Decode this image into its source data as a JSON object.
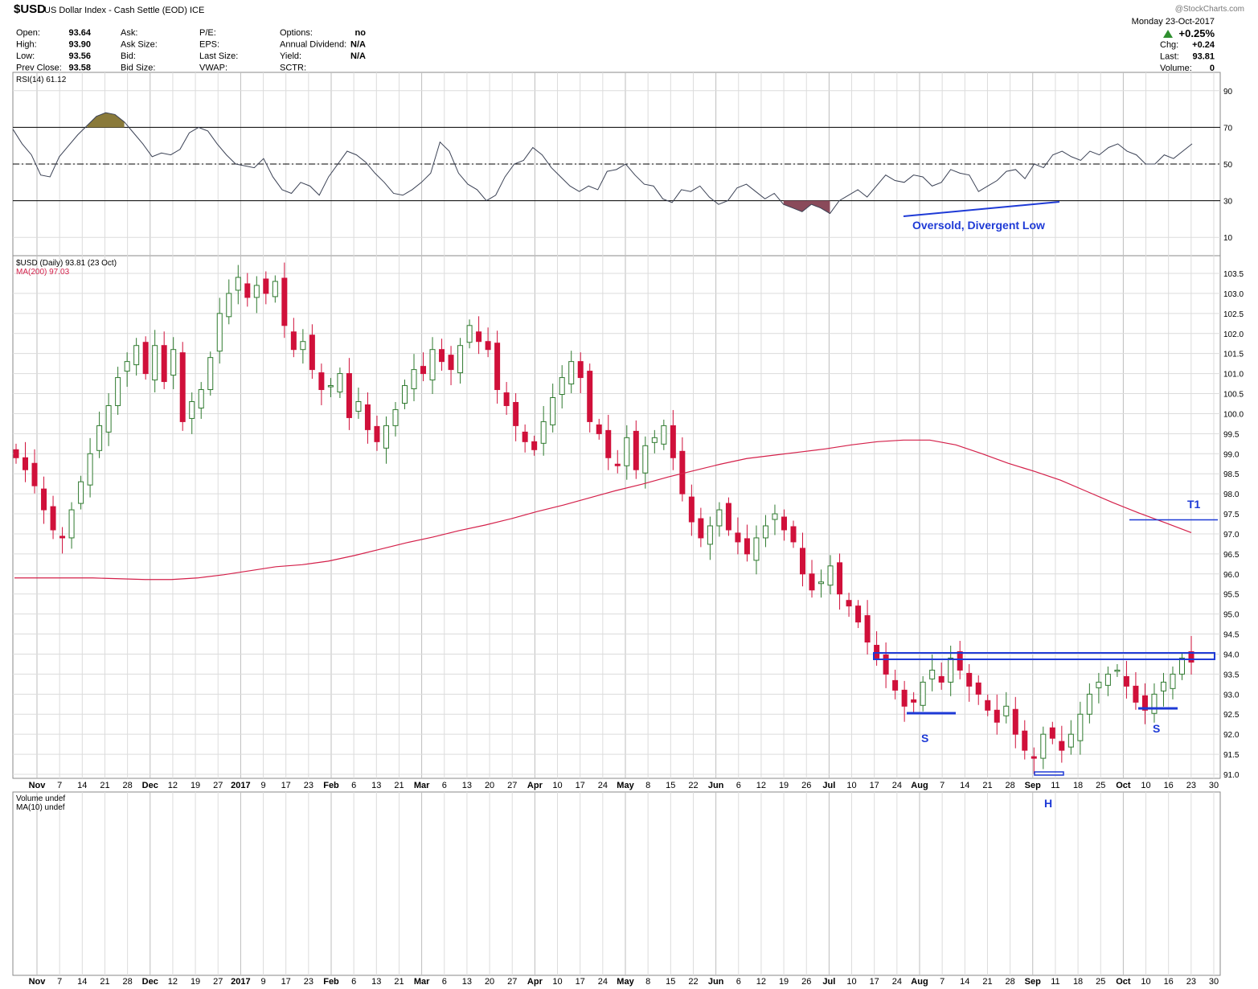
{
  "header": {
    "symbol": "$USD",
    "description": "US Dollar Index - Cash Settle (EOD) ICE",
    "watermark": "@StockCharts.com",
    "date": "Monday 23-Oct-2017",
    "change_pct": "+0.25%",
    "stats_left": [
      {
        "label": "Open:",
        "value": "93.64"
      },
      {
        "label": "High:",
        "value": "93.90"
      },
      {
        "label": "Low:",
        "value": "93.56"
      },
      {
        "label": "Prev Close:",
        "value": "93.58"
      }
    ],
    "stats_mid": [
      "Ask:",
      "Ask Size:",
      "Bid:",
      "Bid Size:"
    ],
    "stats_mid2": [
      "P/E:",
      "EPS:",
      "Last Size:",
      "VWAP:"
    ],
    "stats_right": [
      {
        "label": "Options:",
        "value": "no"
      },
      {
        "label": "Annual Dividend:",
        "value": "N/A"
      },
      {
        "label": "Yield:",
        "value": "N/A"
      },
      {
        "label": "SCTR:",
        "value": ""
      }
    ],
    "stats_far": [
      {
        "label": "Chg:",
        "value": "+0.24"
      },
      {
        "label": "Last:",
        "value": "93.81"
      },
      {
        "label": "Volume:",
        "value": "0"
      }
    ]
  },
  "chart_data": [
    {
      "type": "line",
      "panel": "rsi",
      "legend": "RSI(14) 61.12",
      "ylim": [
        0,
        100
      ],
      "yticks": [
        10,
        30,
        50,
        70,
        90
      ],
      "levels": [
        30,
        50,
        70
      ],
      "series": [
        {
          "name": "RSI(14)",
          "values": [
            69,
            61,
            55,
            44,
            43,
            54,
            60,
            66,
            71,
            76,
            78,
            77,
            73,
            67,
            61,
            54,
            56,
            55,
            58,
            67,
            70,
            68,
            61,
            55,
            50,
            49,
            48,
            53,
            43,
            36,
            34,
            40,
            38,
            33,
            43,
            50,
            57,
            55,
            51,
            45,
            40,
            34,
            33,
            36,
            40,
            45,
            62,
            57,
            45,
            39,
            36,
            30,
            33,
            43,
            50,
            52,
            59,
            55,
            48,
            43,
            38,
            35,
            38,
            36,
            46,
            47,
            50,
            44,
            39,
            38,
            31,
            29,
            36,
            35,
            38,
            32,
            28,
            30,
            37,
            39,
            35,
            31,
            34,
            28,
            26,
            24,
            28,
            26,
            23,
            30,
            33,
            36,
            32,
            38,
            44,
            41,
            40,
            44,
            43,
            38,
            40,
            47,
            45,
            44,
            35,
            38,
            41,
            46,
            47,
            42,
            50,
            48,
            55,
            57,
            54,
            52,
            57,
            55,
            59,
            61,
            57,
            55,
            50,
            50,
            55,
            53,
            57,
            61
          ]
        }
      ],
      "annotations": [
        "Oversold, Divergent Low"
      ]
    },
    {
      "type": "candlestick",
      "panel": "price",
      "legend": "$USD (Daily) 93.81 (23 Oct)",
      "ma_legend": "MA(200) 97.03",
      "ylim": [
        90.9,
        103.8
      ],
      "yticks": [
        "91.0",
        "91.5",
        "92.0",
        "92.5",
        "93.0",
        "93.5",
        "94.0",
        "94.5",
        "95.0",
        "95.5",
        "96.0",
        "96.5",
        "97.0",
        "97.5",
        "98.0",
        "98.5",
        "99.0",
        "99.5",
        "100.0",
        "100.5",
        "101.0",
        "101.5",
        "102.0",
        "102.5",
        "103.0",
        "103.5"
      ],
      "close": [
        98.9,
        98.6,
        98.2,
        97.6,
        97.1,
        96.9,
        97.6,
        98.3,
        99.0,
        99.7,
        100.2,
        100.9,
        101.3,
        101.7,
        101.0,
        101.7,
        100.8,
        101.6,
        99.8,
        100.3,
        100.6,
        101.4,
        102.5,
        103.0,
        103.4,
        102.9,
        103.2,
        103.0,
        103.3,
        102.2,
        101.6,
        101.8,
        101.1,
        100.6,
        100.7,
        101.0,
        99.9,
        100.3,
        99.6,
        99.3,
        99.7,
        100.1,
        100.7,
        101.1,
        101.0,
        101.6,
        101.3,
        101.1,
        101.7,
        102.2,
        101.8,
        101.6,
        100.6,
        100.2,
        99.7,
        99.3,
        99.1,
        99.8,
        100.4,
        100.9,
        101.3,
        100.9,
        99.8,
        99.5,
        98.9,
        98.7,
        99.4,
        98.6,
        99.2,
        99.4,
        99.7,
        98.9,
        98.0,
        97.3,
        96.9,
        97.2,
        97.6,
        97.1,
        96.8,
        96.5,
        96.9,
        97.2,
        97.5,
        97.1,
        96.8,
        96.0,
        95.6,
        95.8,
        96.2,
        95.5,
        95.2,
        94.8,
        94.3,
        93.9,
        93.5,
        93.1,
        92.7,
        92.8,
        93.3,
        93.6,
        93.3,
        93.9,
        93.6,
        93.2,
        93.0,
        92.6,
        92.3,
        92.7,
        92.0,
        91.6,
        91.4,
        92.0,
        91.9,
        91.6,
        92.0,
        92.5,
        93.0,
        93.3,
        93.5,
        93.6,
        93.2,
        92.8,
        92.6,
        93.0,
        93.3,
        93.5,
        93.9,
        93.8
      ],
      "ma200": [
        95.9,
        95.9,
        95.9,
        95.9,
        95.88,
        95.86,
        95.86,
        95.9,
        95.98,
        96.08,
        96.18,
        96.23,
        96.32,
        96.46,
        96.62,
        96.78,
        96.92,
        97.08,
        97.22,
        97.38,
        97.56,
        97.72,
        97.9,
        98.08,
        98.24,
        98.42,
        98.58,
        98.74,
        98.88,
        98.96,
        99.04,
        99.12,
        99.22,
        99.3,
        99.34,
        99.34,
        99.22,
        99.0,
        98.76,
        98.56,
        98.34,
        98.06,
        97.78,
        97.52,
        97.28,
        97.03
      ],
      "levels": {
        "neckline": 93.95,
        "target": 97.35
      },
      "annotations": [
        "S",
        "H",
        "S",
        "T1"
      ]
    },
    {
      "type": "bar",
      "panel": "volume",
      "legend": [
        "Volume undef",
        "MA(10) undef"
      ],
      "values": []
    }
  ],
  "xaxis": {
    "labels": [
      {
        "t": "Nov",
        "b": true
      },
      {
        "t": "7"
      },
      {
        "t": "14"
      },
      {
        "t": "21"
      },
      {
        "t": "28"
      },
      {
        "t": "Dec",
        "b": true
      },
      {
        "t": "12"
      },
      {
        "t": "19"
      },
      {
        "t": "27"
      },
      {
        "t": "2017",
        "b": true
      },
      {
        "t": "9"
      },
      {
        "t": "17"
      },
      {
        "t": "23"
      },
      {
        "t": "Feb",
        "b": true
      },
      {
        "t": "6"
      },
      {
        "t": "13"
      },
      {
        "t": "21"
      },
      {
        "t": "Mar",
        "b": true
      },
      {
        "t": "6"
      },
      {
        "t": "13"
      },
      {
        "t": "20"
      },
      {
        "t": "27"
      },
      {
        "t": "Apr",
        "b": true
      },
      {
        "t": "10"
      },
      {
        "t": "17"
      },
      {
        "t": "24"
      },
      {
        "t": "May",
        "b": true
      },
      {
        "t": "8"
      },
      {
        "t": "15"
      },
      {
        "t": "22"
      },
      {
        "t": "Jun",
        "b": true
      },
      {
        "t": "6"
      },
      {
        "t": "12"
      },
      {
        "t": "19"
      },
      {
        "t": "26"
      },
      {
        "t": "Jul",
        "b": true
      },
      {
        "t": "10"
      },
      {
        "t": "17"
      },
      {
        "t": "24"
      },
      {
        "t": "Aug",
        "b": true
      },
      {
        "t": "7"
      },
      {
        "t": "14"
      },
      {
        "t": "21"
      },
      {
        "t": "28"
      },
      {
        "t": "Sep",
        "b": true
      },
      {
        "t": "11"
      },
      {
        "t": "18"
      },
      {
        "t": "25"
      },
      {
        "t": "Oct",
        "b": true
      },
      {
        "t": "10"
      },
      {
        "t": "16"
      },
      {
        "t": "23"
      },
      {
        "t": "30"
      }
    ]
  },
  "colors": {
    "up": "#2f7a2f",
    "down": "#d0103a",
    "ma200": "#d4204a",
    "annotation": "#1e3ad6",
    "rsi_line": "#3b4255",
    "overbought_fill": "#8a7a3a",
    "oversold_fill": "#8a4a5a",
    "grid": "#dcdcdc",
    "arrow_up": "#2f8f2f"
  }
}
